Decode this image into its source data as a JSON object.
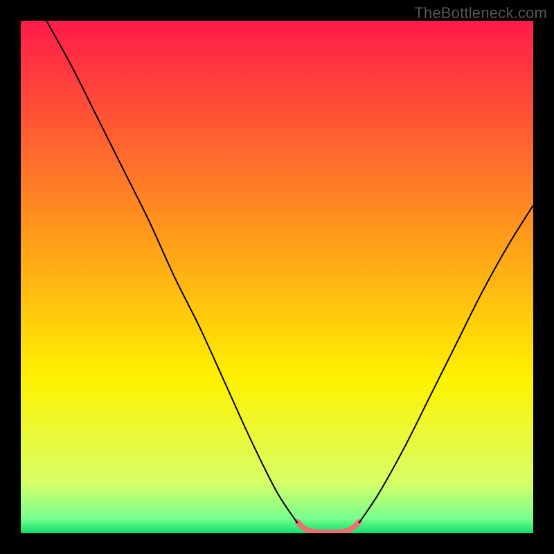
{
  "watermark": {
    "text": "TheBottleneck.com"
  },
  "chart_data": {
    "type": "line",
    "title": "",
    "xlabel": "",
    "ylabel": "",
    "xlim": [
      0,
      100
    ],
    "ylim": [
      0,
      100
    ],
    "grid": false,
    "legend": false,
    "background_gradient": {
      "stops": [
        {
          "offset": 0.0,
          "color": "#ff1a4b"
        },
        {
          "offset": 0.45,
          "color": "#ffa417"
        },
        {
          "offset": 0.7,
          "color": "#fff200"
        },
        {
          "offset": 0.9,
          "color": "#d8ff66"
        },
        {
          "offset": 0.97,
          "color": "#7bff8f"
        },
        {
          "offset": 1.0,
          "color": "#11e06a"
        }
      ]
    },
    "series": [
      {
        "name": "left-curve",
        "color": "#000000",
        "width": 2,
        "x": [
          5,
          10,
          15,
          20,
          25,
          30,
          35,
          40,
          45,
          50,
          54
        ],
        "y": [
          100,
          91,
          81,
          71,
          61,
          50,
          40,
          29,
          18,
          8,
          2
        ]
      },
      {
        "name": "right-curve",
        "color": "#000000",
        "width": 2,
        "x": [
          66,
          70,
          75,
          80,
          85,
          90,
          95,
          100
        ],
        "y": [
          2,
          8,
          17,
          27,
          37,
          47,
          56,
          64
        ]
      },
      {
        "name": "valley-highlight",
        "color": "#e57373",
        "width": 8,
        "linecap": "round",
        "x": [
          54,
          55,
          56,
          58,
          60,
          62,
          64,
          65,
          66
        ],
        "y": [
          2.2,
          1.2,
          0.6,
          0.2,
          0.2,
          0.2,
          0.6,
          1.2,
          2.2
        ]
      }
    ]
  }
}
